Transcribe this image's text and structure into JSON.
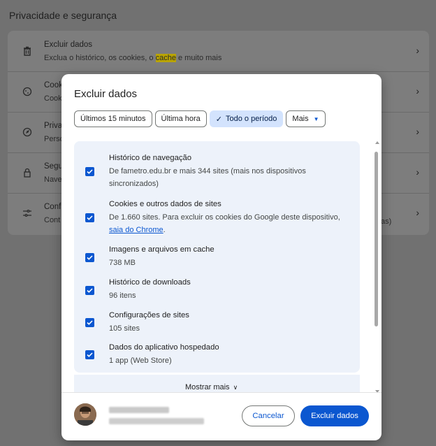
{
  "background": {
    "section_title": "Privacidade e segurança",
    "rows": [
      {
        "title": "Excluir dados",
        "desc_pre": "Exclua o histórico, os cookies, o ",
        "desc_hl": "cache",
        "desc_post": " e muito mais",
        "icon": "trash-icon"
      },
      {
        "title": "Cook",
        "desc": "Cook",
        "icon": "cookie-icon"
      },
      {
        "title": "Priva",
        "desc": "Perso",
        "icon": "compass-icon"
      },
      {
        "title": "Segu",
        "desc": "Nave",
        "icon": "lock-icon"
      },
      {
        "title": "Conf",
        "desc": "Cont",
        "icon": "sliders-icon"
      }
    ],
    "side_fragment": "as)"
  },
  "dialog": {
    "title": "Excluir dados",
    "time_ranges": [
      "Últimos 15 minutos",
      "Última hora",
      "Todo o período",
      "Mais"
    ],
    "selected_range": "Todo o período",
    "items": [
      {
        "title": "Histórico de navegação",
        "desc": "De fametro.edu.br e mais 344 sites (mais nos dispositivos sincronizados)",
        "checked": true
      },
      {
        "title": "Cookies e outros dados de sites",
        "desc_pre": "De 1.660 sites. Para excluir os cookies do Google deste dispositivo, ",
        "link": "saia do Chrome",
        "desc_post": ".",
        "checked": true
      },
      {
        "title": "Imagens e arquivos em cache",
        "desc": "738 MB",
        "checked": true
      },
      {
        "title": "Histórico de downloads",
        "desc": "96 itens",
        "checked": true
      },
      {
        "title": "Configurações de sites",
        "desc": "105 sites",
        "checked": true
      },
      {
        "title": "Dados do aplicativo hospedado",
        "desc": "1 app (Web Store)",
        "checked": true
      }
    ],
    "show_more": "Mostrar mais",
    "cancel": "Cancelar",
    "delete": "Excluir dados"
  },
  "colors": {
    "accent": "#0b57d0",
    "list_bg": "#edf2fa",
    "chip_selected": "#d3e3fd"
  }
}
